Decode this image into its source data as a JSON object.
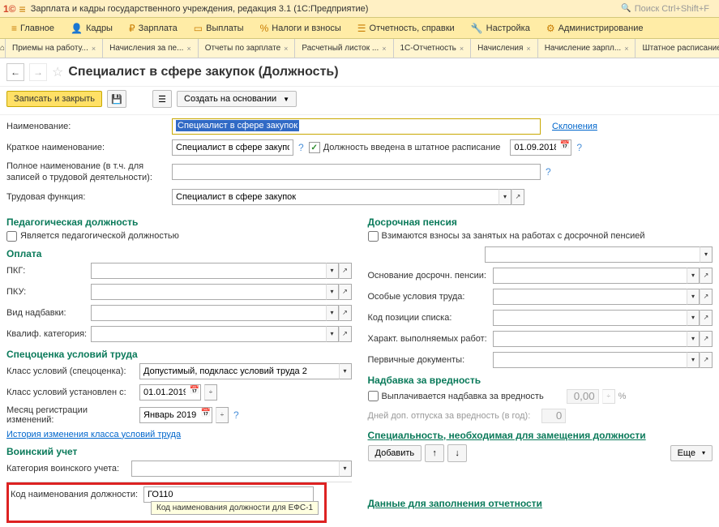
{
  "header": {
    "title": "Зарплата и кадры государственного учреждения, редакция 3.1  (1С:Предприятие)",
    "search_placeholder": "Поиск Ctrl+Shift+F"
  },
  "menu": {
    "items": [
      {
        "label": "Главное",
        "icon": "≡"
      },
      {
        "label": "Кадры",
        "icon": "👤"
      },
      {
        "label": "Зарплата",
        "icon": "💰"
      },
      {
        "label": "Выплаты",
        "icon": "💳"
      },
      {
        "label": "Налоги и взносы",
        "icon": "%"
      },
      {
        "label": "Отчетность, справки",
        "icon": "☰"
      },
      {
        "label": "Настройка",
        "icon": "🔧"
      },
      {
        "label": "Администрирование",
        "icon": "⚙"
      }
    ]
  },
  "tabs": {
    "items": [
      "Приемы на работу...",
      "Начисления за пе...",
      "Отчеты по зарплате",
      "Расчетный листок ...",
      "1С-Отчетность",
      "Начисления",
      "Начисление зарпл...",
      "Штатное расписание"
    ]
  },
  "object": {
    "title": "Специалист в сфере закупок (Должность)",
    "actions": {
      "save_close": "Записать и закрыть",
      "create_based": "Создать на основании"
    }
  },
  "form": {
    "name_label": "Наименование:",
    "name_value": "Специалист в сфере закупок",
    "declensions_link": "Склонения",
    "short_label": "Краткое наименование:",
    "short_value": "Специалист в сфере закупо",
    "in_staff_label": "Должность введена в штатное расписание",
    "in_staff_date": "01.09.2018",
    "full_label": "Полное наименование (в т.ч. для записей о трудовой деятельности):",
    "full_value": "",
    "func_label": "Трудовая функция:",
    "func_value": "Специалист в сфере закупок"
  },
  "ped": {
    "header": "Педагогическая должность",
    "is_ped": "Является педагогической должностью"
  },
  "pension": {
    "header": "Досрочная пенсия",
    "cb": "Взимаются взносы за занятых на работах с досрочной пенсией",
    "base_label": "Основание досрочн. пенсии:",
    "cond_label": "Особые условия труда:",
    "pos_label": "Код позиции списка:",
    "work_label": "Характ. выполняемых работ:",
    "docs_label": "Первичные документы:"
  },
  "pay": {
    "header": "Оплата",
    "pkg": "ПКГ:",
    "pku": "ПКУ:",
    "allowance": "Вид надбавки:",
    "qual": "Квалиф. категория:"
  },
  "harm": {
    "header": "Надбавка за вредность",
    "cb": "Выплачивается надбавка за вредность",
    "pct": "0,00",
    "days_label": "Дней доп. отпуска за вредность (в год):",
    "days": "0"
  },
  "spec": {
    "header": "Специальность, необходимая для замещения должности",
    "add": "Добавить",
    "more": "Еще"
  },
  "assess": {
    "header": "Спецоценка условий труда",
    "class_label": "Класс условий (спецоценка):",
    "class_value": "Допустимый, подкласс условий труда 2",
    "from_label": "Класс условий установлен с:",
    "from_value": "01.01.2019",
    "month_label": "Месяц регистрации изменений:",
    "month_value": "Январь 2019",
    "history_link": "История изменения класса условий труда"
  },
  "mil": {
    "header": "Воинский учет",
    "cat_label": "Категория воинского учета:",
    "code_label": "Код наименования должности:",
    "code_value": "ГО110",
    "tooltip": "Код наименования должности для ЕФС-1"
  },
  "report": {
    "header": "Данные для заполнения отчетности"
  }
}
